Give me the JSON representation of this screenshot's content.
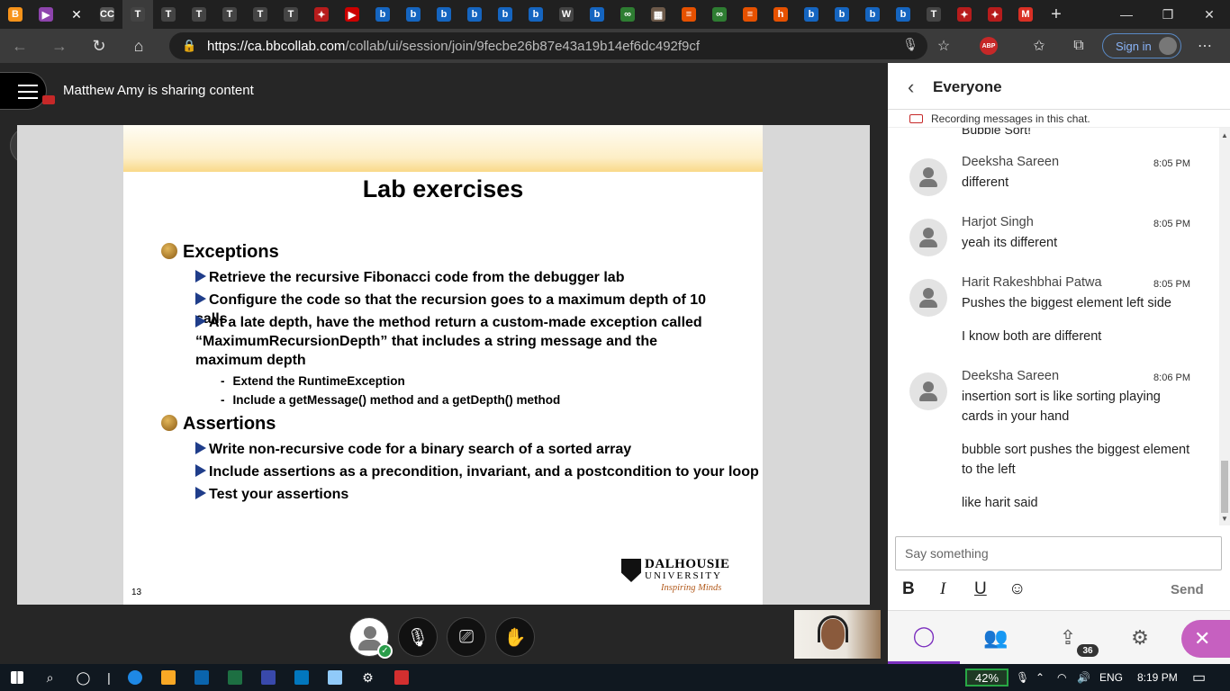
{
  "browser": {
    "tabs": [
      {
        "name": "tab-bitcoin",
        "glyph": "B",
        "color": "#f7931a"
      },
      {
        "name": "tab-video",
        "glyph": "▶",
        "color": "#8e44ad"
      },
      {
        "name": "tab-cc",
        "glyph": "CC",
        "color": "#555"
      },
      {
        "name": "tab-notes-1",
        "glyph": "T",
        "color": "#444"
      },
      {
        "name": "tab-notes-2",
        "glyph": "T",
        "color": "#444"
      },
      {
        "name": "tab-notes-3",
        "glyph": "T",
        "color": "#444"
      },
      {
        "name": "tab-notes-4",
        "glyph": "T",
        "color": "#444"
      },
      {
        "name": "tab-notes-5",
        "glyph": "T",
        "color": "#444"
      },
      {
        "name": "tab-notes-6",
        "glyph": "T",
        "color": "#444"
      },
      {
        "name": "tab-maple-1",
        "glyph": "✦",
        "color": "#b71c1c"
      },
      {
        "name": "tab-youtube",
        "glyph": "▶",
        "color": "#c00"
      },
      {
        "name": "tab-bing-1",
        "glyph": "b",
        "color": "#1565c0"
      },
      {
        "name": "tab-bing-2",
        "glyph": "b",
        "color": "#1565c0"
      },
      {
        "name": "tab-bing-3",
        "glyph": "b",
        "color": "#1565c0"
      },
      {
        "name": "tab-bing-4",
        "glyph": "b",
        "color": "#1565c0"
      },
      {
        "name": "tab-bing-5",
        "glyph": "b",
        "color": "#1565c0"
      },
      {
        "name": "tab-bing-6",
        "glyph": "b",
        "color": "#1565c0"
      },
      {
        "name": "tab-wordpress",
        "glyph": "W",
        "color": "#444"
      },
      {
        "name": "tab-bing-7",
        "glyph": "b",
        "color": "#1565c0"
      },
      {
        "name": "tab-infinity-1",
        "glyph": "∞",
        "color": "#2e7d32"
      },
      {
        "name": "tab-image",
        "glyph": "▦",
        "color": "#6d5a4a"
      },
      {
        "name": "tab-stack-1",
        "glyph": "≡",
        "color": "#e65100"
      },
      {
        "name": "tab-infinity-2",
        "glyph": "∞",
        "color": "#2e7d32"
      },
      {
        "name": "tab-stack-2",
        "glyph": "≡",
        "color": "#e65100"
      },
      {
        "name": "tab-h",
        "glyph": "h",
        "color": "#e65100"
      },
      {
        "name": "tab-bing-8",
        "glyph": "b",
        "color": "#1565c0"
      },
      {
        "name": "tab-bing-9",
        "glyph": "b",
        "color": "#1565c0"
      },
      {
        "name": "tab-bing-10",
        "glyph": "b",
        "color": "#1565c0"
      },
      {
        "name": "tab-bing-11",
        "glyph": "b",
        "color": "#1565c0"
      },
      {
        "name": "tab-notes-7",
        "glyph": "T",
        "color": "#444"
      },
      {
        "name": "tab-maple-2",
        "glyph": "✦",
        "color": "#b71c1c"
      },
      {
        "name": "tab-maple-3",
        "glyph": "✦",
        "color": "#b71c1c"
      },
      {
        "name": "tab-gmail",
        "glyph": "M",
        "color": "#d93025"
      }
    ],
    "url_host": "https://ca.bbcollab.com",
    "url_path": "/collab/ui/session/join/9fecbe26b87e43a19b14ef6dc492f9cf",
    "abp": "ABP",
    "signin": "Sign in"
  },
  "session": {
    "sharing_text": "Matthew Amy is sharing content"
  },
  "slide": {
    "title": "Lab exercises",
    "exceptions": "Exceptions",
    "ex_items": [
      "Retrieve the recursive Fibonacci code from the debugger lab",
      "Configure the code so that the recursion goes to a maximum depth of 10 calls",
      "At a late depth, have the method return a custom-made exception called “MaximumRecursionDepth” that includes a string message and the maximum depth"
    ],
    "sub_items": [
      "Extend the RuntimeException",
      "Include a getMessage() method and a getDepth() method"
    ],
    "assertions": "Assertions",
    "as_items": [
      "Write non-recursive code for a binary search of a sorted array",
      "Include assertions as a precondition, invariant, and a postcondition to your loop",
      "Test your assertions"
    ],
    "number": "13",
    "logo_name": "DALHOUSIE",
    "logo_uni": "UNIVERSITY",
    "logo_tag": "Inspiring Minds"
  },
  "chat": {
    "title": "Everyone",
    "recording_note": "Recording messages in this chat.",
    "partial_text": "Bubble Sort!",
    "messages": [
      {
        "name": "Deeksha Sareen",
        "time": "8:05 PM",
        "texts": [
          "different"
        ]
      },
      {
        "name": "Harjot Singh",
        "time": "8:05 PM",
        "texts": [
          "yeah its different"
        ]
      },
      {
        "name": "Harit Rakeshbhai Patwa",
        "time": "8:05 PM",
        "texts": [
          "Pushes the biggest element left side",
          "I know both are different"
        ]
      },
      {
        "name": "Deeksha Sareen",
        "time": "8:06 PM",
        "texts": [
          "insertion sort is like sorting playing cards in your hand",
          "bubble sort pushes the biggest element to the left",
          "like harit said"
        ]
      }
    ],
    "placeholder": "Say something",
    "send": "Send",
    "attendee_count": "36"
  },
  "taskbar": {
    "battery": "42%",
    "lang": "ENG",
    "time": "8:19 PM"
  }
}
